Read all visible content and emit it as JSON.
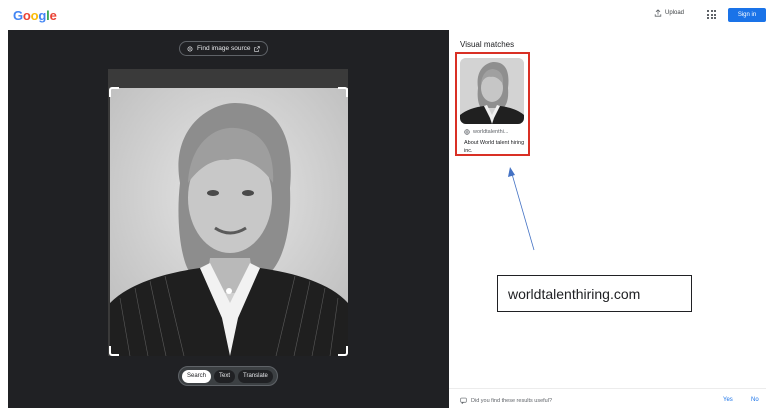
{
  "header": {
    "logo_letters": [
      {
        "ch": "G",
        "color": "#4285f4"
      },
      {
        "ch": "o",
        "color": "#ea4335"
      },
      {
        "ch": "o",
        "color": "#fbbc05"
      },
      {
        "ch": "g",
        "color": "#4285f4"
      },
      {
        "ch": "l",
        "color": "#34a853"
      },
      {
        "ch": "e",
        "color": "#ea4335"
      }
    ],
    "upload_label": "Upload",
    "upload_icon": "upload-icon",
    "apps_icon": "apps-grid-icon",
    "signin_label": "Sign in"
  },
  "viewer": {
    "find_source_label": "Find image source",
    "find_source_icon": "lens-icon",
    "open_icon": "open-in-new-icon",
    "modes": [
      {
        "label": "Search",
        "active": true
      },
      {
        "label": "Text",
        "active": false
      },
      {
        "label": "Translate",
        "active": false
      }
    ]
  },
  "results": {
    "title": "Visual matches",
    "match": {
      "site": "worldtalenthi...",
      "title": "About World talent hiring inc.",
      "highlight_color": "#d93025"
    },
    "annotation_text": "worldtalenthiring.com",
    "annotation_arrow_color": "#4472c4",
    "feedback_question": "Did you find these results useful?",
    "feedback_yes": "Yes",
    "feedback_no": "No"
  }
}
